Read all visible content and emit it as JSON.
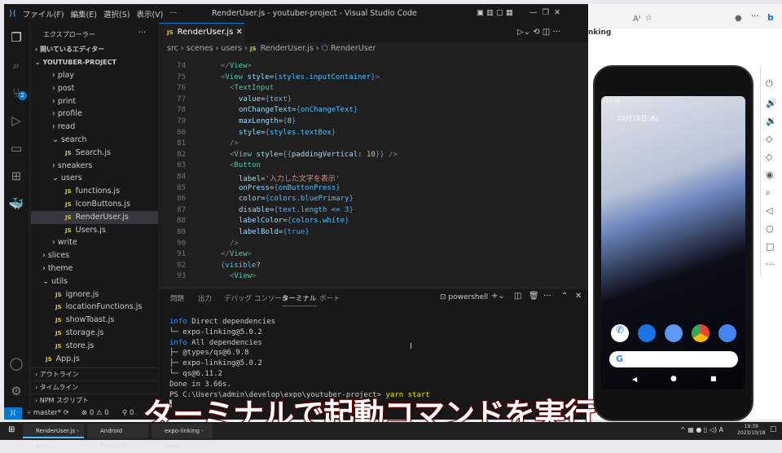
{
  "titlebar": {
    "menus": [
      "ファイル(F)",
      "編集(E)",
      "選択(S)",
      "表示(V)",
      "···"
    ],
    "title": "RenderUser.js - youtuber-project - Visual Studio Code"
  },
  "activity": {
    "scm_badge": "2"
  },
  "sidebar": {
    "header": "エクスプローラー",
    "more": "···",
    "open_editors": "開いているエディター",
    "project": "YOUTUBER-PROJECT",
    "items": [
      {
        "label": "play",
        "type": "folder",
        "open": false,
        "depth": 2
      },
      {
        "label": "post",
        "type": "folder",
        "open": false,
        "depth": 2
      },
      {
        "label": "print",
        "type": "folder",
        "open": false,
        "depth": 2
      },
      {
        "label": "profile",
        "type": "folder",
        "open": false,
        "depth": 2
      },
      {
        "label": "read",
        "type": "folder",
        "open": false,
        "depth": 2
      },
      {
        "label": "search",
        "type": "folder",
        "open": true,
        "depth": 2
      },
      {
        "label": "Search.js",
        "type": "file",
        "depth": 3
      },
      {
        "label": "sneakers",
        "type": "folder",
        "open": false,
        "depth": 2
      },
      {
        "label": "users",
        "type": "folder",
        "open": true,
        "depth": 2
      },
      {
        "label": "functions.js",
        "type": "file",
        "depth": 3
      },
      {
        "label": "IconButtons.js",
        "type": "file",
        "depth": 3
      },
      {
        "label": "RenderUser.js",
        "type": "file",
        "depth": 3,
        "selected": true
      },
      {
        "label": "Users.js",
        "type": "file",
        "depth": 3
      },
      {
        "label": "write",
        "type": "folder",
        "open": false,
        "depth": 2
      },
      {
        "label": "slices",
        "type": "folder",
        "open": false,
        "depth": 1
      },
      {
        "label": "theme",
        "type": "folder",
        "open": false,
        "depth": 1
      },
      {
        "label": "utils",
        "type": "folder",
        "open": true,
        "depth": 1
      },
      {
        "label": "ignore.js",
        "type": "file",
        "depth": 2
      },
      {
        "label": "locationFunctions.js",
        "type": "file",
        "depth": 2
      },
      {
        "label": "showToast.js",
        "type": "file",
        "depth": 2
      },
      {
        "label": "storage.js",
        "type": "file",
        "depth": 2
      },
      {
        "label": "store.js",
        "type": "file",
        "depth": 2
      },
      {
        "label": "App.js",
        "type": "file",
        "depth": 1
      }
    ],
    "sections": [
      "アウトライン",
      "タイムライン",
      "NPM スクリプト"
    ]
  },
  "editor": {
    "tab": "RenderUser.js",
    "breadcrumb": [
      "src",
      "scenes",
      "users",
      "RenderUser.js",
      "RenderUser"
    ],
    "lines": [
      {
        "n": "74",
        "i": 3,
        "t": [
          [
            "</",
            "p"
          ],
          [
            "View",
            "t"
          ],
          [
            ">",
            "p"
          ]
        ]
      },
      {
        "n": "75",
        "i": 3,
        "t": [
          [
            "<",
            "p"
          ],
          [
            "View",
            "t"
          ],
          [
            " style",
            "a"
          ],
          [
            "=",
            "w"
          ],
          [
            "{",
            "b"
          ],
          [
            "styles.inputContainer",
            "v"
          ],
          [
            "}",
            "b"
          ],
          [
            ">",
            "p"
          ]
        ]
      },
      {
        "n": "76",
        "i": 4,
        "t": [
          [
            "<",
            "p"
          ],
          [
            "TextInput",
            "t"
          ]
        ]
      },
      {
        "n": "77",
        "i": 5,
        "t": [
          [
            "value",
            "a"
          ],
          [
            "=",
            "w"
          ],
          [
            "{",
            "b"
          ],
          [
            "text",
            "v"
          ],
          [
            "}",
            "b"
          ]
        ]
      },
      {
        "n": "78",
        "i": 5,
        "t": [
          [
            "onChangeText",
            "a"
          ],
          [
            "=",
            "w"
          ],
          [
            "{",
            "b"
          ],
          [
            "onChangeText",
            "v"
          ],
          [
            "}",
            "b"
          ]
        ]
      },
      {
        "n": "79",
        "i": 5,
        "t": [
          [
            "maxLength",
            "a"
          ],
          [
            "=",
            "w"
          ],
          [
            "{",
            "b"
          ],
          [
            "8",
            "n"
          ],
          [
            "}",
            "b"
          ]
        ]
      },
      {
        "n": "80",
        "i": 5,
        "t": [
          [
            "style",
            "a"
          ],
          [
            "=",
            "w"
          ],
          [
            "{",
            "b"
          ],
          [
            "styles.textBox",
            "v"
          ],
          [
            "}",
            "b"
          ]
        ]
      },
      {
        "n": "81",
        "i": 4,
        "t": [
          [
            "/>",
            "p"
          ]
        ]
      },
      {
        "n": "82",
        "i": 4,
        "t": [
          [
            "<",
            "p"
          ],
          [
            "View",
            "t"
          ],
          [
            " style",
            "a"
          ],
          [
            "=",
            "w"
          ],
          [
            "{{",
            "b"
          ],
          [
            "paddingVertical",
            "a"
          ],
          [
            ": ",
            "w"
          ],
          [
            "10",
            "n"
          ],
          [
            "}}",
            "b"
          ],
          [
            " />",
            "p"
          ]
        ]
      },
      {
        "n": "83",
        "i": 4,
        "t": [
          [
            "<",
            "p"
          ],
          [
            "Button",
            "t"
          ]
        ]
      },
      {
        "n": "84",
        "i": 5,
        "t": [
          [
            "label",
            "a"
          ],
          [
            "=",
            "w"
          ],
          [
            "'入力した文字を表示'",
            "s"
          ]
        ]
      },
      {
        "n": "85",
        "i": 5,
        "t": [
          [
            "onPress",
            "a"
          ],
          [
            "=",
            "w"
          ],
          [
            "{",
            "b"
          ],
          [
            "onButtonPress",
            "v"
          ],
          [
            "}",
            "b"
          ]
        ]
      },
      {
        "n": "86",
        "i": 5,
        "t": [
          [
            "color",
            "a"
          ],
          [
            "=",
            "w"
          ],
          [
            "{",
            "b"
          ],
          [
            "colors.bluePrimary",
            "v"
          ],
          [
            "}",
            "b"
          ]
        ]
      },
      {
        "n": "87",
        "i": 5,
        "t": [
          [
            "disable",
            "a"
          ],
          [
            "=",
            "w"
          ],
          [
            "{",
            "b"
          ],
          [
            "text.length <= 3",
            "v"
          ],
          [
            "}",
            "b"
          ]
        ]
      },
      {
        "n": "88",
        "i": 5,
        "t": [
          [
            "labelColor",
            "a"
          ],
          [
            "=",
            "w"
          ],
          [
            "{",
            "b"
          ],
          [
            "colors.white",
            "v"
          ],
          [
            "}",
            "b"
          ]
        ]
      },
      {
        "n": "89",
        "i": 5,
        "t": [
          [
            "labelBold",
            "a"
          ],
          [
            "=",
            "w"
          ],
          [
            "{",
            "b"
          ],
          [
            "true",
            "k"
          ],
          [
            "}",
            "b"
          ]
        ]
      },
      {
        "n": "90",
        "i": 4,
        "t": [
          [
            "/>",
            "p"
          ]
        ]
      },
      {
        "n": "91",
        "i": 3,
        "t": [
          [
            "</",
            "p"
          ],
          [
            "View",
            "t"
          ],
          [
            ">",
            "p"
          ]
        ]
      },
      {
        "n": "92",
        "i": 3,
        "t": [
          [
            "{",
            "b"
          ],
          [
            "visible",
            "v"
          ],
          [
            "?",
            "w"
          ]
        ]
      },
      {
        "n": "93",
        "i": 4,
        "t": [
          [
            "<",
            "p"
          ],
          [
            "View",
            "t"
          ],
          [
            ">",
            "p"
          ]
        ]
      }
    ]
  },
  "panel": {
    "tabs": [
      "問題",
      "出力",
      "デバッグ コンソール",
      "ターミナル",
      "ポート"
    ],
    "active": 3,
    "shell": "powershell",
    "terminal": [
      {
        "pre": "info",
        "text": " Direct dependencies"
      },
      {
        "text": "└─ expo-linking@5.0.2"
      },
      {
        "pre": "info",
        "text": " All dependencies"
      },
      {
        "text": "├─ @types/qs@6.9.8"
      },
      {
        "text": "├─ expo-linking@5.0.2"
      },
      {
        "text": "└─ qs@6.11.2"
      },
      {
        "text": "Done in 3.66s."
      },
      {
        "text": "PS C:\\Users\\admin\\develop\\expo\\youtuber-project> ",
        "cmd": "yarn start"
      }
    ]
  },
  "status": {
    "branch": "master*",
    "errors": "0",
    "warnings": "0",
    "ports": "0"
  },
  "browser": {
    "heading_fragment": "nking"
  },
  "phone": {
    "time": "10:39",
    "date": "10月18日(水)"
  },
  "caption": "ターミナルで起動コマンドを実行",
  "taskbar": {
    "items": [
      "RenderUser.js - you...",
      "Android Emulator -...",
      "expo-linking - npm..."
    ],
    "time": "19:39",
    "date": "2023/10/18"
  },
  "colors": {
    "accent": "#0078d4",
    "caption_outline": "#7a0000"
  }
}
